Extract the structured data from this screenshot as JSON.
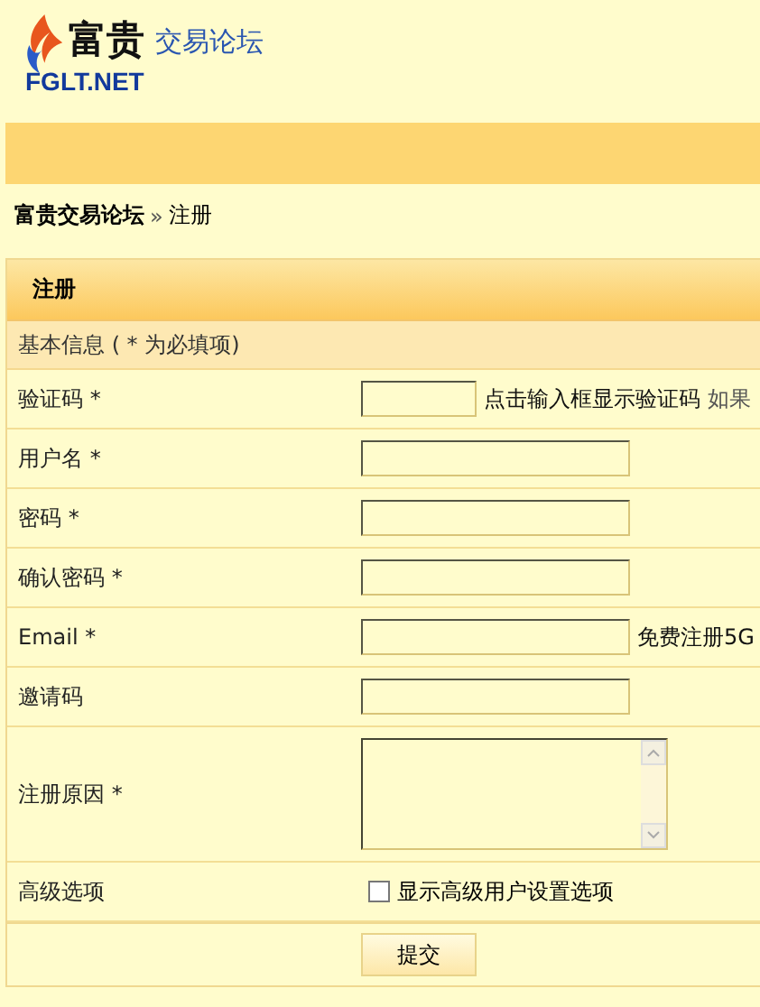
{
  "logo": {
    "title": "富贵",
    "subtitle": "交易论坛",
    "domain": "FGLT.NET"
  },
  "breadcrumb": {
    "home": "富贵交易论坛",
    "separator": "»",
    "current": "注册"
  },
  "form": {
    "title": "注册",
    "section": "基本信息 ( * 为必填项)",
    "rows": [
      {
        "kind": "code",
        "label": "验证码 *",
        "hint": "点击输入框显示验证码",
        "hint_extra": "如果"
      },
      {
        "kind": "field",
        "label": "用户名 *"
      },
      {
        "kind": "field",
        "label": "密码 *"
      },
      {
        "kind": "field",
        "label": "确认密码 *"
      },
      {
        "kind": "field",
        "label": "Email *",
        "hint": "免费注册5G"
      },
      {
        "kind": "field",
        "label": "邀请码"
      },
      {
        "kind": "textarea",
        "label": "注册原因 *"
      },
      {
        "kind": "checkbox",
        "label": "高级选项",
        "option": "显示高级用户设置选项",
        "checked": false
      }
    ],
    "submit": "提交"
  }
}
